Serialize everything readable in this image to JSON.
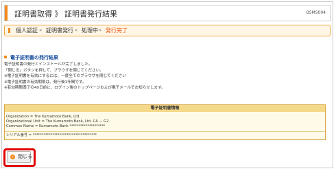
{
  "header": {
    "title": "証明書取得 》 証明書発行結果",
    "screen_code": "BSMS004"
  },
  "steps": {
    "items": [
      "個人認証",
      "証明書発行",
      "処理中",
      "発行完了"
    ],
    "separator": "»",
    "current_color": "#e8540e"
  },
  "section": {
    "title": "電子証明書の発行結果",
    "lines": [
      "電子証明書の発行とインストールが完了しました。",
      "「閉じる」ボタンを押して、ブラウザを閉じてください。",
      "※電子証明書を有効にするには、一度全てのブラウザを閉じてください",
      "※電子証明書の有効期限は、発行後1年間です。",
      "※有効期間満了の40日前に、ログイン後のトップページおよび電子メールでお知らせします。"
    ]
  },
  "certificate": {
    "heading": "電子証明書情報",
    "lines": [
      "Organization = The Kumamoto Bank, Ltd.",
      "Organizational Unit = The Kumamoto Bank, Ltd. CA － G2",
      "Common Name = Kumamoto Bank ********************"
    ],
    "serial": "シリアル番号 = ************************************"
  },
  "close_button": {
    "label": "閉じる",
    "icon": "close-circle-icon",
    "highlight_color": "#e00000"
  },
  "colors": {
    "accent": "#f28c1e",
    "section_title": "#1a4fa0"
  }
}
